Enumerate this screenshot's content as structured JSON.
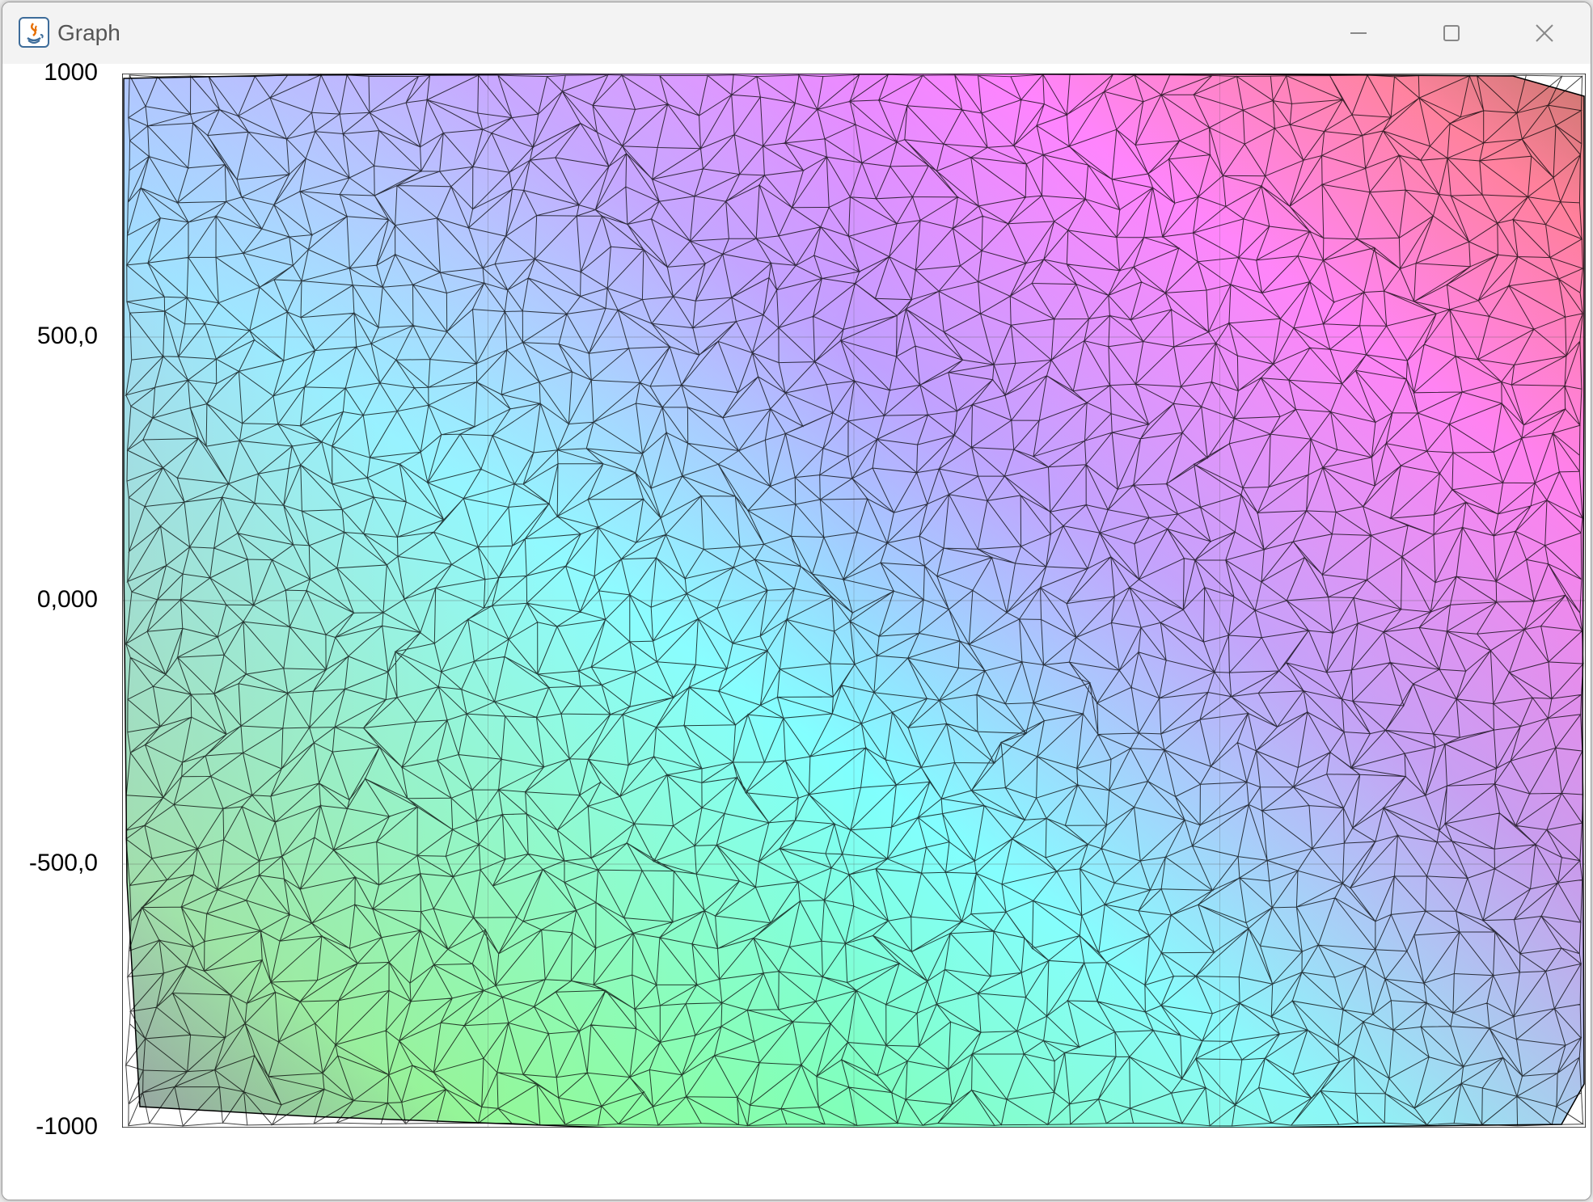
{
  "window": {
    "title": "Graph",
    "controls": [
      "minimize",
      "maximize",
      "close"
    ],
    "app_icon": "java-icon"
  },
  "chart_data": {
    "type": "heatmap",
    "description_type": "delaunay triangulation mesh colored by position",
    "title": "",
    "xlabel": "",
    "ylabel": "",
    "ylim": [
      -1000,
      1000
    ],
    "xlim": [
      -1000,
      1000
    ],
    "y_ticks": [
      "1000",
      "500,0",
      "0,000",
      "-500,0",
      "-1000"
    ],
    "y_tick_values": [
      1000,
      500,
      0,
      -500,
      -1000
    ],
    "grid": true,
    "legend": "none",
    "colors": {
      "top_left": "#e891ff",
      "top_center": "#ff7fd9",
      "top_right": "#c2756b",
      "upper_right": "#ff7f7f",
      "middle": "#ff80ff",
      "center_left": "#8fd6ff",
      "center": "#80ffff",
      "lower_left": "#80ff80",
      "bottom_left": "#6f9e6f",
      "bottom_right": "#80ffff",
      "mesh_line": "#000000"
    }
  }
}
